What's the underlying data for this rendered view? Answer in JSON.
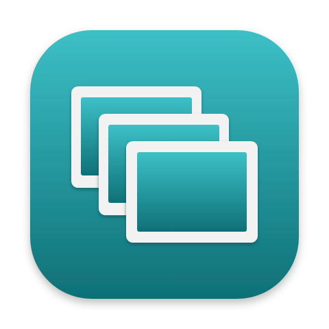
{
  "app_icon": {
    "name": "stacked-windows-icon",
    "colors": {
      "background_top": "#3cc0c6",
      "background_bottom": "#0f7077",
      "frame": "#f2f2f2",
      "frame_shadow": "#0b4f55",
      "page_background": "#ffffff"
    }
  }
}
